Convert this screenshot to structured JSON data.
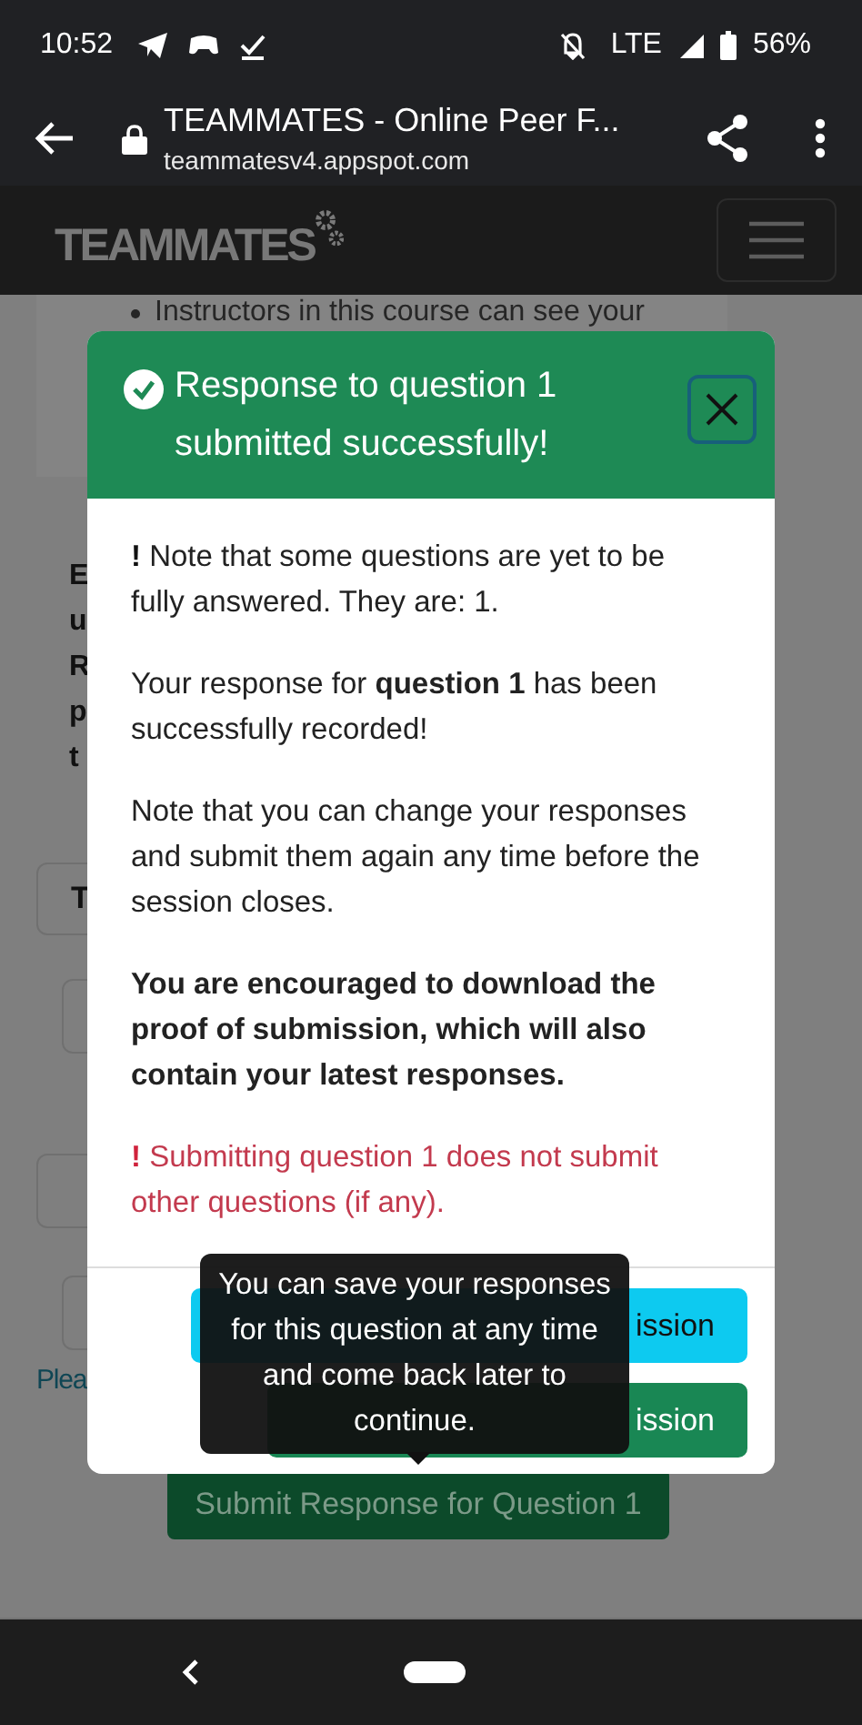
{
  "status_bar": {
    "time": "10:52",
    "network": "LTE",
    "battery": "56%"
  },
  "browser": {
    "title": "TEAMMATES - Online Peer F...",
    "url": "teammatesv4.appspot.com"
  },
  "navbar": {
    "logo": "TEAMMATES"
  },
  "page": {
    "bullet": "Instructors in this course can see your",
    "side_letters": [
      "E",
      "u",
      "R",
      "p",
      "t"
    ],
    "box_letter": "T",
    "link": "Plea",
    "submit_button": "Submit Response for Question 1"
  },
  "modal": {
    "title": "Response to question 1 submitted successfully!",
    "paragraphs": [
      {
        "kind": "warning",
        "mark": "!",
        "text": "Note that some questions are yet to be fully answered. They are: 1."
      },
      {
        "kind": "plain",
        "text": "Your response for **question 1** has been successfully recorded!"
      },
      {
        "kind": "plain",
        "text": "Note that you can change your responses and submit them again any time before the session closes."
      },
      {
        "kind": "bold",
        "text": "You are encouraged to download the proof of submission, which will also contain your latest responses."
      },
      {
        "kind": "danger",
        "mark": "!",
        "text": "Submitting question 1 does not submit other questions (if any)."
      }
    ],
    "buttons": [
      {
        "kind": "info",
        "label": "ission"
      },
      {
        "kind": "success",
        "label": "ission"
      }
    ]
  },
  "tooltip": "You can save your responses for this question at any time and come back later to continue."
}
